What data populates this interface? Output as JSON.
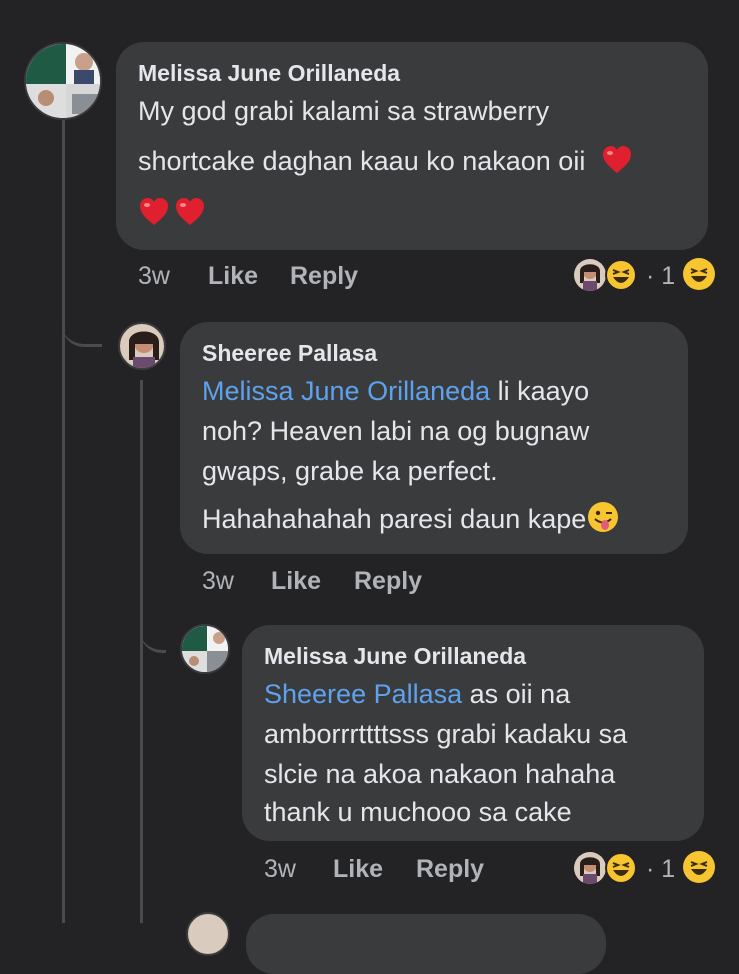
{
  "comments": [
    {
      "author": "Melissa June Orillaneda",
      "lines": [
        "My god grabi kalami sa strawberry",
        "shortcake daghan kaau ko nakaon oii"
      ],
      "time": "3w",
      "like_label": "Like",
      "reply_label": "Reply",
      "reaction_count": "· 1"
    },
    {
      "author": "Sheeree Pallasa",
      "mention": "Melissa June Orillaneda",
      "line1_rest": " li kaayo",
      "lines": [
        "noh? Heaven labi na og bugnaw",
        "gwaps, grabe ka perfect.",
        "Hahahahahah paresi daun kape"
      ],
      "time": "3w",
      "like_label": "Like",
      "reply_label": "Reply"
    },
    {
      "author": "Melissa June Orillaneda",
      "mention": "Sheeree Pallasa",
      "line1_rest": " as oii na",
      "lines": [
        "amborrrttttsss grabi kadaku sa",
        "slcie na akoa nakaon hahaha",
        "thank u muchooo sa cake"
      ],
      "time": "3w",
      "like_label": "Like",
      "reply_label": "Reply",
      "reaction_count": "· 1"
    }
  ],
  "icons": {
    "heart": "red-heart-emoji",
    "laugh": "grinning-squinting-face-emoji",
    "wink": "winking-face-tongue-emoji"
  },
  "colors": {
    "background": "#232325",
    "bubble": "#3a3b3c",
    "text": "#e4e6eb",
    "meta": "#b0b3b8",
    "mention": "#5ea2ee"
  }
}
